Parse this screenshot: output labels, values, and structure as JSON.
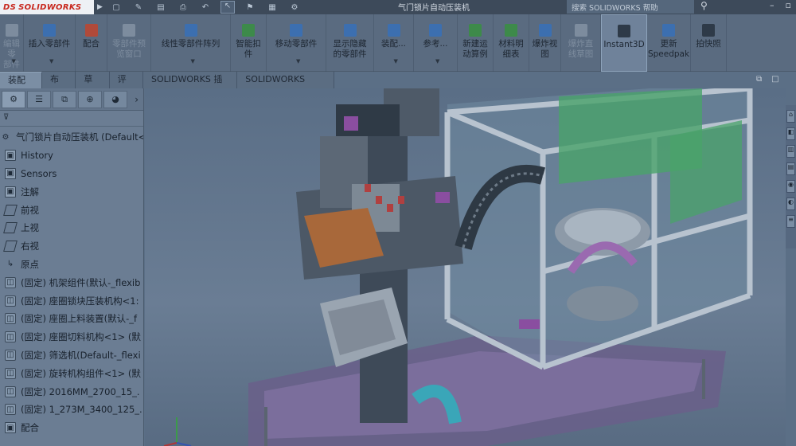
{
  "app": {
    "brand": "SOLIDWORKS",
    "brand_prefix": "DS",
    "document_title": "气门锁片自动压装机",
    "help_search_placeholder": "搜索 SOLIDWORKS 帮助"
  },
  "quick_access": [
    "new-icon",
    "open-icon",
    "save-icon",
    "print-icon",
    "undo-icon",
    "select-icon",
    "rebuild-icon",
    "file-properties-icon",
    "options-icon"
  ],
  "commands": [
    {
      "label": "编辑零\n部件",
      "icon": "edit-component-icon",
      "dim": true
    },
    {
      "label": "插入零部件",
      "icon": "insert-component-icon",
      "dim": false
    },
    {
      "label": "配合",
      "icon": "mate-icon",
      "dim": false
    },
    {
      "label": "零部件预\n览窗口",
      "icon": "component-preview-icon",
      "dim": true
    },
    {
      "label": "线性零部件阵列",
      "icon": "linear-pattern-icon",
      "dim": false
    },
    {
      "label": "智能扣\n件",
      "icon": "smart-fasteners-icon",
      "dim": false
    },
    {
      "label": "移动零部件",
      "icon": "move-component-icon",
      "dim": false
    },
    {
      "label": "显示隐藏\n的零部件",
      "icon": "show-hidden-icon",
      "dim": false
    },
    {
      "label": "装配...",
      "icon": "assembly-features-icon",
      "dim": false
    },
    {
      "label": "参考...",
      "icon": "reference-geometry-icon",
      "dim": false
    },
    {
      "label": "新建运\n动算例",
      "icon": "motion-study-icon",
      "dim": false
    },
    {
      "label": "材料明\n细表",
      "icon": "bom-icon",
      "dim": false
    },
    {
      "label": "爆炸视\n图",
      "icon": "exploded-view-icon",
      "dim": false
    },
    {
      "label": "爆炸直\n线草图",
      "icon": "explode-line-sketch-icon",
      "dim": true
    },
    {
      "label": "Instant3D",
      "icon": "instant3d-icon",
      "dim": false,
      "active": true
    },
    {
      "label": "更新\nSpeedpak",
      "icon": "speedpak-icon",
      "dim": false
    },
    {
      "label": "拍快照",
      "icon": "snapshot-icon",
      "dim": false
    }
  ],
  "tabs": [
    "装配体",
    "布局",
    "草图",
    "评估",
    "SOLIDWORKS 插件",
    "SOLIDWORKS MBD"
  ],
  "feature_manager": {
    "panel_tabs": [
      "feature-tree-icon",
      "property-manager-icon",
      "config-manager-icon",
      "dimxpert-icon",
      "display-manager-icon"
    ],
    "filter_icon": "filter-icon",
    "tree": [
      {
        "label": "气门锁片自动压装机 (Default<",
        "icon": "assembly-icon",
        "kind": "root"
      },
      {
        "label": "History",
        "icon": "history-icon",
        "kind": "folder"
      },
      {
        "label": "Sensors",
        "icon": "sensors-icon",
        "kind": "folder"
      },
      {
        "label": "注解",
        "icon": "annotations-icon",
        "kind": "folder"
      },
      {
        "label": "前视",
        "icon": "plane-icon",
        "kind": "plane"
      },
      {
        "label": "上视",
        "icon": "plane-icon",
        "kind": "plane"
      },
      {
        "label": "右视",
        "icon": "plane-icon",
        "kind": "plane"
      },
      {
        "label": "原点",
        "icon": "origin-icon",
        "kind": "origin"
      },
      {
        "label": "(固定) 机架组件(默认-_flexib",
        "icon": "subassembly-icon",
        "kind": "part"
      },
      {
        "label": "(固定) 座圈锁块压装机构<1:",
        "icon": "subassembly-icon",
        "kind": "part"
      },
      {
        "label": "(固定) 座圈上料装置(默认-_f",
        "icon": "subassembly-icon",
        "kind": "part"
      },
      {
        "label": "(固定) 座圈切料机构<1> (默",
        "icon": "subassembly-icon",
        "kind": "part"
      },
      {
        "label": "(固定) 筛选机(Default-_flexi",
        "icon": "subassembly-icon",
        "kind": "part"
      },
      {
        "label": "(固定) 旋转机构组件<1> (默",
        "icon": "subassembly-icon",
        "kind": "part"
      },
      {
        "label": "(固定) 2016MM_2700_15_.",
        "icon": "part-icon",
        "kind": "part"
      },
      {
        "label": "(固定) 1_273M_3400_125_.",
        "icon": "part-icon",
        "kind": "part"
      },
      {
        "label": "配合",
        "icon": "mates-folder-icon",
        "kind": "folder"
      }
    ]
  },
  "colors": {
    "frame": "#b8c3cf",
    "machine_dark": "#3e4a58",
    "accent_green": "#4aa36a",
    "accent_purple": "#8a4ea0",
    "accent_orange": "#a8683a",
    "accent_cyan": "#3aa6b8",
    "accent_red": "#b04040"
  }
}
